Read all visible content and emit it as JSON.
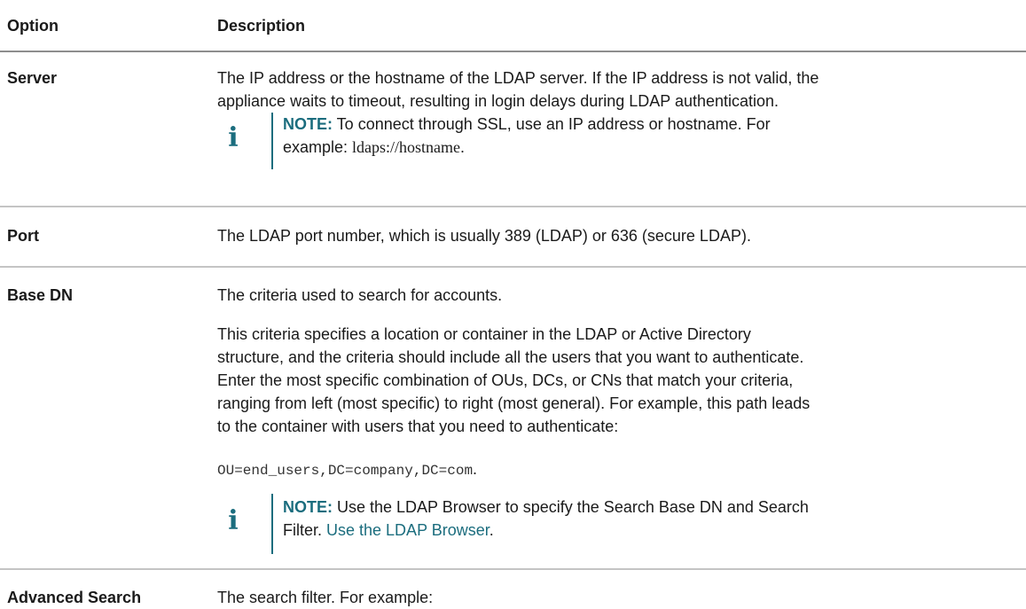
{
  "table": {
    "headers": {
      "option": "Option",
      "description": "Description"
    },
    "rows": {
      "server": {
        "option": "Server",
        "desc_line1": "The IP address or the hostname of the LDAP server. If the IP address is not valid, the",
        "desc_line2": "appliance waits to timeout, resulting in login delays during LDAP authentication.",
        "note_label": "NOTE:",
        "note_line1": " To connect through SSL, use an IP address or hostname. For",
        "note_line2_prefix": "example: ",
        "note_code": "ldaps://hostname",
        "note_line2_suffix": "."
      },
      "port": {
        "option": "Port",
        "desc": "The LDAP port number, which is usually 389 (LDAP) or 636 (secure LDAP)."
      },
      "base_dn": {
        "option": "Base DN",
        "desc_p1": "The criteria used to search for accounts.",
        "desc_p2_line1": "This criteria specifies a location or container in the LDAP or Active Directory",
        "desc_p2_line2": "structure, and the criteria should include all the users that you want to authenticate.",
        "desc_p2_line3": "Enter the most specific combination of OUs, DCs, or CNs that match your criteria,",
        "desc_p2_line4": "ranging from left (most specific) to right (most general). For example, this path leads",
        "desc_p2_line5": "to the container with users that you need to authenticate:",
        "example_code": "OU=end_users,DC=company,DC=com",
        "example_suffix": ".",
        "note_label": "NOTE:",
        "note_line1": " Use the LDAP Browser to specify the Search Base DN and Search",
        "note_line2_prefix": "Filter. ",
        "note_link": "Use the LDAP Browser",
        "note_line2_suffix": "."
      },
      "advanced_search": {
        "option": "Advanced Search",
        "desc": "The search filter. For example:"
      }
    }
  },
  "icons": {
    "note": "info-icon"
  },
  "colors": {
    "accent": "#1b6d7e"
  }
}
